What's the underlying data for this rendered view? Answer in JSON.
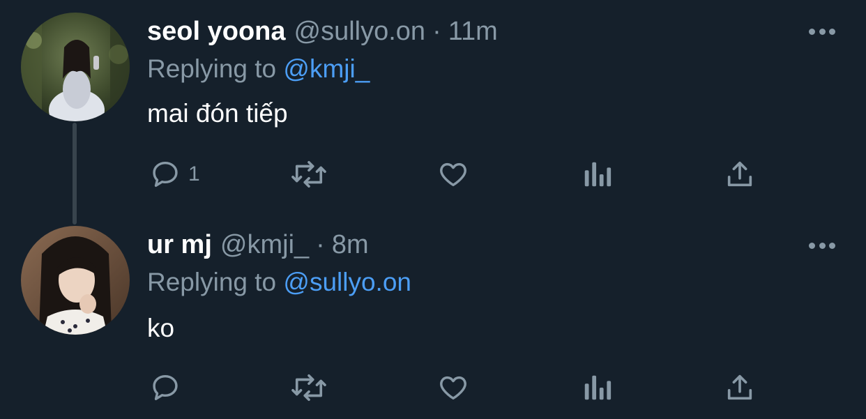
{
  "thread": [
    {
      "display_name": "seol yoona",
      "handle": "@sullyo.on",
      "separator": "·",
      "time": "11m",
      "replying_prefix": "Replying to",
      "replying_to": "@kmji_",
      "text": "mai đón tiếp",
      "reply_count": "1",
      "avatar": "avatar-photo"
    },
    {
      "display_name": "ur mj",
      "handle": "@kmji_",
      "separator": "·",
      "time": "8m",
      "replying_prefix": "Replying to",
      "replying_to": "@sullyo.on",
      "text": "ko",
      "reply_count": "",
      "avatar": "avatar-photo"
    }
  ],
  "icons": [
    "reply-icon",
    "retweet-icon",
    "like-icon",
    "analytics-icon",
    "share-icon",
    "more-icon"
  ],
  "colors": {
    "background": "#15202b",
    "secondary_text": "#8899a6",
    "link": "#4c9ef5",
    "text": "#ffffff"
  }
}
